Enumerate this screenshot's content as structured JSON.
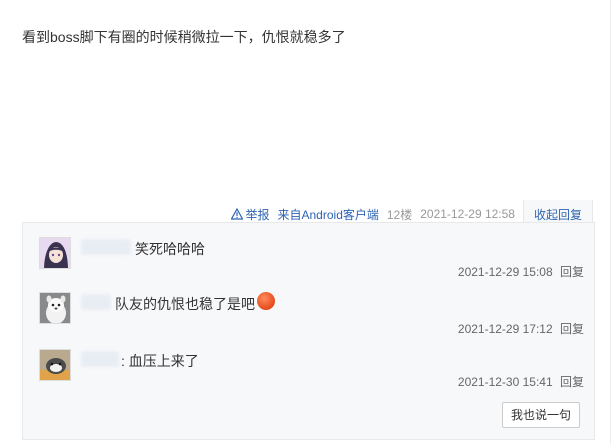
{
  "post": {
    "text": "看到boss脚下有圈的时候稍微拉一下，仇恨就稳多了"
  },
  "tail": {
    "report_label": "举报",
    "source": "来自Android客户端",
    "floor": "12楼",
    "time": "2021-12-29 12:58",
    "collapse_label": "收起回复"
  },
  "replies": [
    {
      "content": "笑死哈哈哈",
      "time": "2021-12-29 15:08",
      "reply_label": "回复"
    },
    {
      "content": "队友的仇恨也稳了是吧",
      "time": "2021-12-29 17:12",
      "reply_label": "回复"
    },
    {
      "content": ": 血压上来了",
      "time": "2021-12-30 15:41",
      "reply_label": "回复"
    }
  ],
  "say_button": "我也说一句",
  "colors": {
    "link": "#2d64b3",
    "panel_bg": "#f7f8fa",
    "emoji": "#e54b1c"
  }
}
